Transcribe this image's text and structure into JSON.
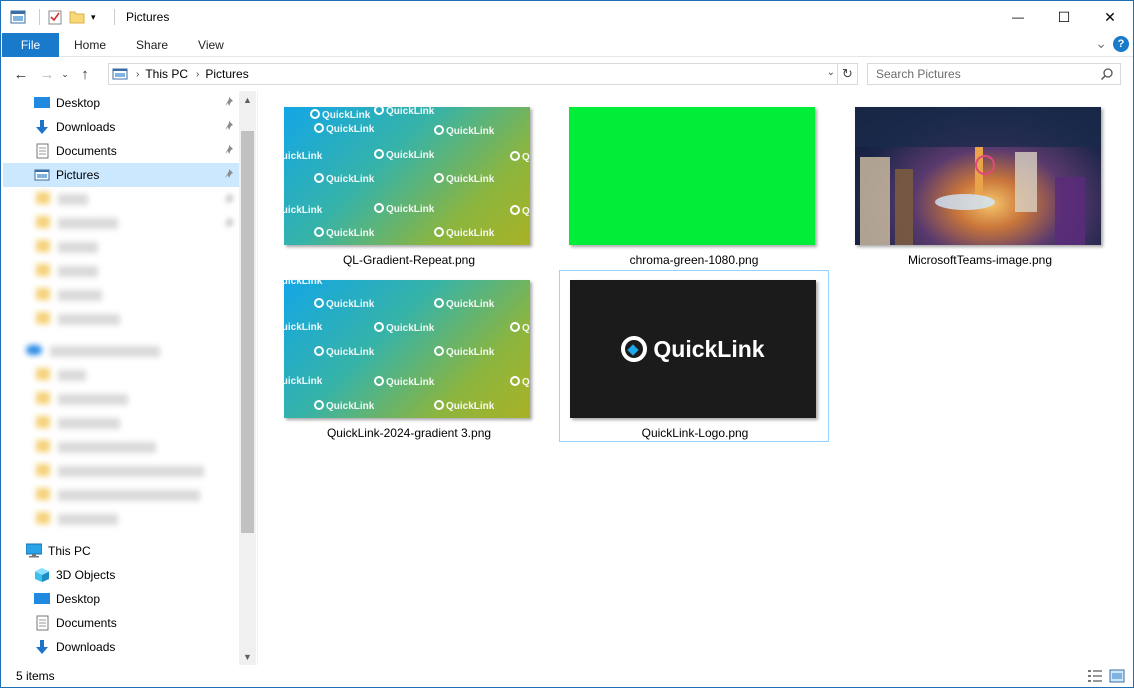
{
  "window": {
    "title": "Pictures",
    "controls": {
      "minimize": "—",
      "maximize": "☐",
      "close": "✕"
    }
  },
  "ribbon": {
    "tabs": [
      "File",
      "Home",
      "Share",
      "View"
    ],
    "expand_glyph": "⌄",
    "help_glyph": "?"
  },
  "address": {
    "crumbs": [
      "This PC",
      "Pictures"
    ],
    "search_placeholder": "Search Pictures"
  },
  "nav": {
    "quick_access": [
      {
        "label": "Desktop",
        "icon": "desktop-icon",
        "pinned": true
      },
      {
        "label": "Downloads",
        "icon": "downloads-icon",
        "pinned": true
      },
      {
        "label": "Documents",
        "icon": "documents-icon",
        "pinned": true
      },
      {
        "label": "Pictures",
        "icon": "pictures-icon",
        "pinned": true,
        "selected": true
      }
    ],
    "blurred_items_count": 14,
    "this_pc": {
      "label": "This PC",
      "children": [
        {
          "label": "3D Objects",
          "icon": "3d-objects-icon"
        },
        {
          "label": "Desktop",
          "icon": "desktop-icon"
        },
        {
          "label": "Documents",
          "icon": "documents-icon"
        },
        {
          "label": "Downloads",
          "icon": "downloads-icon"
        }
      ]
    }
  },
  "files": [
    {
      "name": "QL-Gradient-Repeat.png",
      "kind": "gradient",
      "watermark": "QuickLink"
    },
    {
      "name": "chroma-green-1080.png",
      "kind": "green"
    },
    {
      "name": "MicrosoftTeams-image.png",
      "kind": "photo"
    },
    {
      "name": "QuickLink-2024-gradient 3.png",
      "kind": "gradient",
      "watermark": "QuickLink"
    },
    {
      "name": "QuickLink-Logo.png",
      "kind": "logo",
      "logo_text": "QuickLink",
      "selected": true
    }
  ],
  "status": {
    "item_count": "5 items"
  },
  "colors": {
    "accent": "#1979ca",
    "selection": "#cce8ff",
    "green": "#00ee37"
  }
}
